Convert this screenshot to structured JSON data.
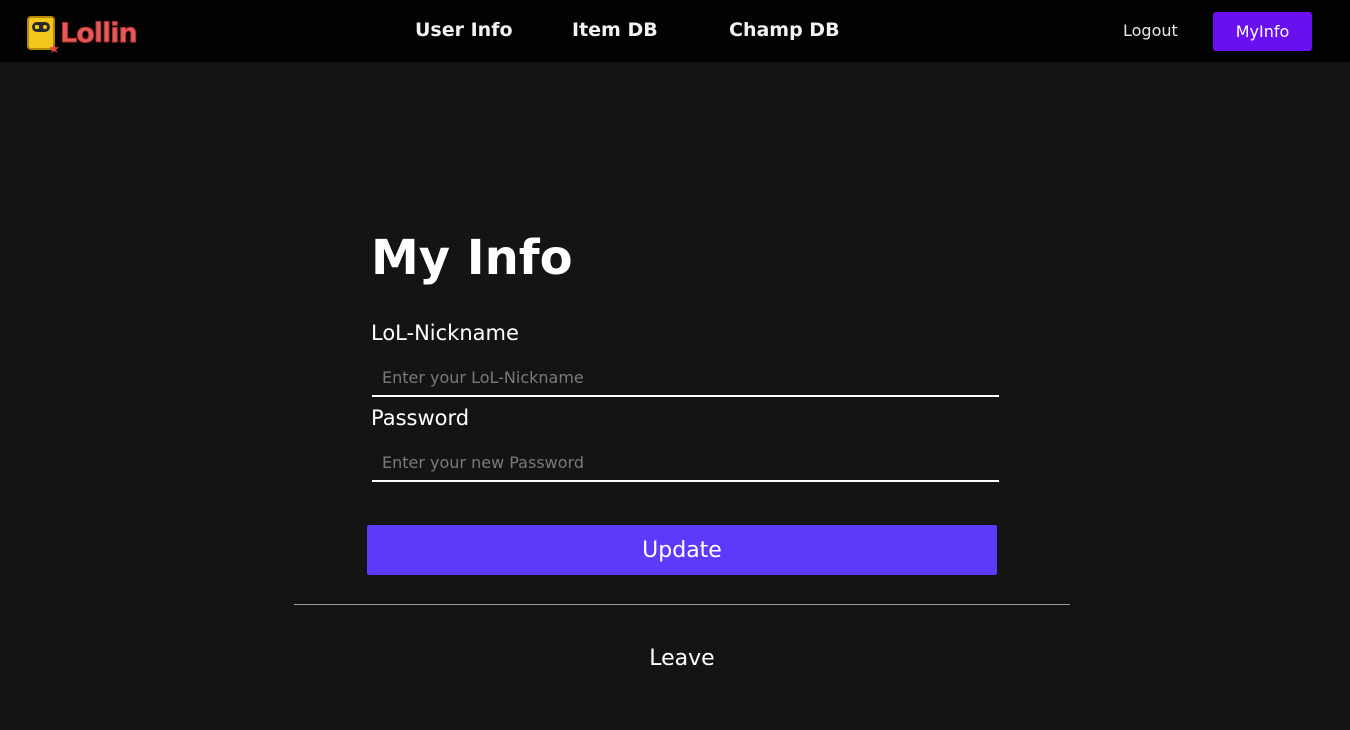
{
  "navbar": {
    "logo_text": "Lollin",
    "links": [
      {
        "label": "User Info"
      },
      {
        "label": "Item DB"
      },
      {
        "label": "Champ DB"
      }
    ],
    "logout_label": "Logout",
    "myinfo_label": "MyInfo"
  },
  "form": {
    "title": "My Info",
    "nickname": {
      "label": "LoL-Nickname",
      "placeholder": "Enter your LoL-Nickname",
      "value": ""
    },
    "password": {
      "label": "Password",
      "placeholder": "Enter your new Password",
      "value": ""
    },
    "update_label": "Update",
    "leave_label": "Leave"
  },
  "colors": {
    "background": "#141414",
    "navbar": "#020202",
    "myinfo_button": "#6a0ff0",
    "update_button": "#5c39fb",
    "logo_text": "#e35a5a",
    "logo_badge": "#f2c81f"
  }
}
